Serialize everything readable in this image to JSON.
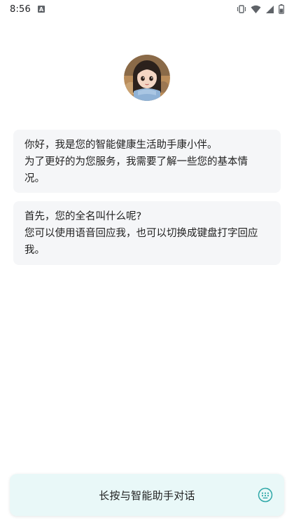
{
  "status_bar": {
    "time": "8:56",
    "notification_icon": "a-box-icon",
    "icons": [
      "vibrate-icon",
      "wifi-icon",
      "signal-icon",
      "battery-icon"
    ]
  },
  "assistant": {
    "avatar": "assistant-avatar"
  },
  "messages": [
    {
      "lines": [
        "你好，我是您的智能健康生活助手康小伴。",
        "为了更好的为您服务，我需要了解一些您的基本情",
        "况。"
      ]
    },
    {
      "lines": [
        "首先，您的全名叫什么呢?",
        "您可以使用语音回应我，也可以切换成键盘打字回应",
        "我。"
      ]
    }
  ],
  "talk_bar": {
    "label": "长按与智能助手对话",
    "keyboard_icon": "keyboard-icon"
  },
  "colors": {
    "bubble_bg": "#f5f6f8",
    "talk_bar_bg": "#e9f8f8",
    "accent": "#2fa8a8"
  }
}
